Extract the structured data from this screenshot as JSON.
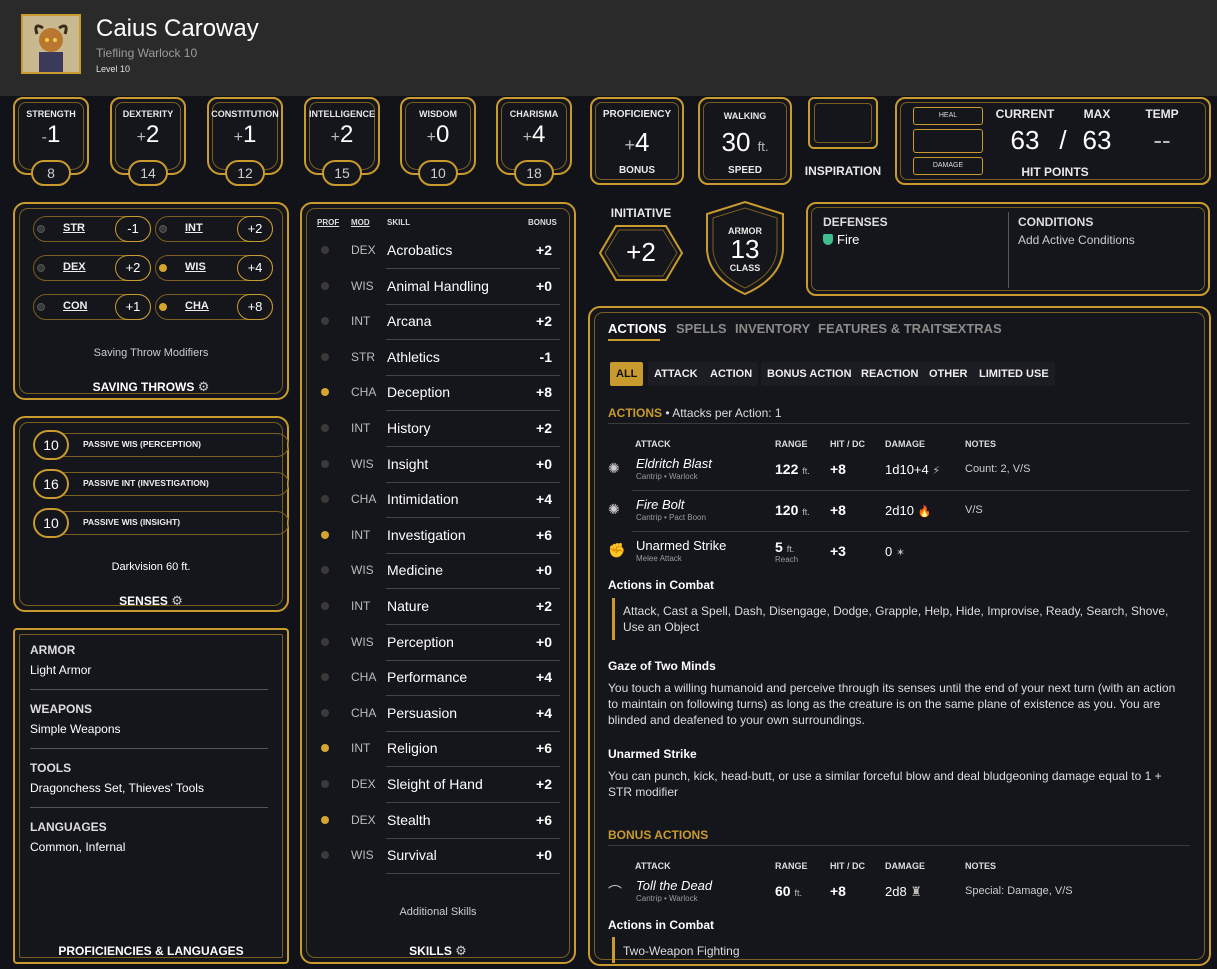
{
  "character": {
    "name": "Caius Caroway",
    "race_class": "Tiefling  Warlock 10",
    "level": "Level 10"
  },
  "abilities": [
    {
      "label": "STRENGTH",
      "sign": "-",
      "mod": "1",
      "score": "8"
    },
    {
      "label": "DEXTERITY",
      "sign": "+",
      "mod": "2",
      "score": "14"
    },
    {
      "label": "CONSTITUTION",
      "sign": "+",
      "mod": "1",
      "score": "12"
    },
    {
      "label": "INTELLIGENCE",
      "sign": "+",
      "mod": "2",
      "score": "15"
    },
    {
      "label": "WISDOM",
      "sign": "+",
      "mod": "0",
      "score": "10"
    },
    {
      "label": "CHARISMA",
      "sign": "+",
      "mod": "4",
      "score": "18"
    }
  ],
  "proficiency": {
    "top": "PROFICIENCY",
    "sign": "+",
    "value": "4",
    "bottom": "BONUS"
  },
  "speed": {
    "top": "WALKING",
    "value": "30",
    "unit": "ft.",
    "bottom": "SPEED"
  },
  "inspiration": {
    "label": "INSPIRATION"
  },
  "hit_points": {
    "heal": "HEAL",
    "damage": "DAMAGE",
    "current_label": "CURRENT",
    "max_label": "MAX",
    "temp_label": "TEMP",
    "current": "63",
    "slash": "/",
    "max": "63",
    "temp": "--",
    "title": "HIT POINTS"
  },
  "initiative": {
    "label": "INITIATIVE",
    "value": "+2"
  },
  "armor": {
    "top": "ARMOR",
    "value": "13",
    "bottom": "CLASS"
  },
  "defenses": {
    "label": "DEFENSES",
    "value": "Fire"
  },
  "conditions": {
    "label": "CONDITIONS",
    "value": "Add Active Conditions"
  },
  "saving_throws": {
    "items": [
      {
        "abbr": "STR",
        "val": "-1",
        "prof": false
      },
      {
        "abbr": "INT",
        "val": "+2",
        "prof": false
      },
      {
        "abbr": "DEX",
        "val": "+2",
        "prof": false
      },
      {
        "abbr": "WIS",
        "val": "+4",
        "prof": true
      },
      {
        "abbr": "CON",
        "val": "+1",
        "prof": false
      },
      {
        "abbr": "CHA",
        "val": "+8",
        "prof": true
      }
    ],
    "caption": "Saving Throw Modifiers",
    "title": "SAVING THROWS"
  },
  "senses": {
    "items": [
      {
        "val": "10",
        "label": "PASSIVE WIS (PERCEPTION)"
      },
      {
        "val": "16",
        "label": "PASSIVE INT (INVESTIGATION)"
      },
      {
        "val": "10",
        "label": "PASSIVE WIS (INSIGHT)"
      }
    ],
    "caption": "Darkvision 60 ft.",
    "title": "SENSES"
  },
  "proficiencies": {
    "groups": [
      {
        "head": "ARMOR",
        "value": "Light Armor"
      },
      {
        "head": "WEAPONS",
        "value": "Simple Weapons"
      },
      {
        "head": "TOOLS",
        "value": "Dragonchess Set, Thieves' Tools"
      },
      {
        "head": "LANGUAGES",
        "value": "Common, Infernal"
      }
    ],
    "title": "PROFICIENCIES & LANGUAGES"
  },
  "skills": {
    "headers": {
      "prof": "PROF",
      "mod": "MOD",
      "skill": "SKILL",
      "bonus": "BONUS"
    },
    "items": [
      {
        "prof": false,
        "mod": "DEX",
        "name": "Acrobatics",
        "bonus": "+2"
      },
      {
        "prof": false,
        "mod": "WIS",
        "name": "Animal Handling",
        "bonus": "+0"
      },
      {
        "prof": false,
        "mod": "INT",
        "name": "Arcana",
        "bonus": "+2"
      },
      {
        "prof": false,
        "mod": "STR",
        "name": "Athletics",
        "bonus": "-1"
      },
      {
        "prof": true,
        "mod": "CHA",
        "name": "Deception",
        "bonus": "+8"
      },
      {
        "prof": false,
        "mod": "INT",
        "name": "History",
        "bonus": "+2"
      },
      {
        "prof": false,
        "mod": "WIS",
        "name": "Insight",
        "bonus": "+0"
      },
      {
        "prof": false,
        "mod": "CHA",
        "name": "Intimidation",
        "bonus": "+4"
      },
      {
        "prof": true,
        "mod": "INT",
        "name": "Investigation",
        "bonus": "+6"
      },
      {
        "prof": false,
        "mod": "WIS",
        "name": "Medicine",
        "bonus": "+0"
      },
      {
        "prof": false,
        "mod": "INT",
        "name": "Nature",
        "bonus": "+2"
      },
      {
        "prof": false,
        "mod": "WIS",
        "name": "Perception",
        "bonus": "+0"
      },
      {
        "prof": false,
        "mod": "CHA",
        "name": "Performance",
        "bonus": "+4"
      },
      {
        "prof": false,
        "mod": "CHA",
        "name": "Persuasion",
        "bonus": "+4"
      },
      {
        "prof": true,
        "mod": "INT",
        "name": "Religion",
        "bonus": "+6"
      },
      {
        "prof": false,
        "mod": "DEX",
        "name": "Sleight of Hand",
        "bonus": "+2"
      },
      {
        "prof": true,
        "mod": "DEX",
        "name": "Stealth",
        "bonus": "+6"
      },
      {
        "prof": false,
        "mod": "WIS",
        "name": "Survival",
        "bonus": "+0"
      }
    ],
    "additional": "Additional Skills",
    "title": "SKILLS"
  },
  "actions": {
    "tabs": [
      "ACTIONS",
      "SPELLS",
      "INVENTORY",
      "FEATURES & TRAITS",
      "EXTRAS"
    ],
    "filters": [
      "ALL",
      "ATTACK",
      "ACTION",
      "BONUS ACTION",
      "REACTION",
      "OTHER",
      "LIMITED USE"
    ],
    "section_title": "ACTIONS",
    "section_sub": "• Attacks per Action: 1",
    "table_headers": {
      "attack": "ATTACK",
      "range": "RANGE",
      "hit": "HIT / DC",
      "damage": "DAMAGE",
      "notes": "NOTES"
    },
    "attacks": [
      {
        "name": "Eldritch Blast",
        "sub": "Cantrip • Warlock",
        "range": "122",
        "range_unit": "ft.",
        "range_sub": "",
        "hit": "+8",
        "damage": "1d10+4",
        "notes": "Count: 2, V/S",
        "italic": true
      },
      {
        "name": "Fire Bolt",
        "sub": "Cantrip • Pact Boon",
        "range": "120",
        "range_unit": "ft.",
        "range_sub": "",
        "hit": "+8",
        "damage": "2d10",
        "notes": "V/S",
        "italic": true
      },
      {
        "name": "Unarmed Strike",
        "sub": "Melee Attack",
        "range": "5",
        "range_unit": "ft.",
        "range_sub": "Reach",
        "hit": "+3",
        "damage": "0",
        "notes": "",
        "italic": false
      }
    ],
    "combat_head": "Actions in Combat",
    "combat_text": "Attack, Cast a Spell, Dash, Disengage, Dodge, Grapple, Help, Hide, Improvise, Ready, Search, Shove, Use an Object",
    "gaze_head": "Gaze of Two Minds",
    "gaze_text": "You touch a willing humanoid and perceive through its senses until the end of your next turn (with an action to maintain on following turns) as long as the creature is on the same plane of existence as you. You are blinded and deafened to your own surroundings.",
    "unarmed_head": "Unarmed Strike",
    "unarmed_text": "You can punch, kick, head-butt, or use a similar forceful blow and deal bludgeoning damage equal to 1 + STR modifier",
    "bonus_title": "BONUS ACTIONS",
    "bonus_attack": {
      "name": "Toll the Dead",
      "sub": "Cantrip • Warlock",
      "range": "60",
      "range_unit": "ft.",
      "hit": "+8",
      "damage": "2d8",
      "notes": "Special: Damage, V/S"
    },
    "bonus_combat_head": "Actions in Combat",
    "bonus_combat_text": "Two-Weapon Fighting"
  },
  "colors": {
    "accent": "#c99a2e",
    "background": "#111318",
    "header": "#2a2a2a",
    "defense_icon": "#3fbf8f"
  }
}
